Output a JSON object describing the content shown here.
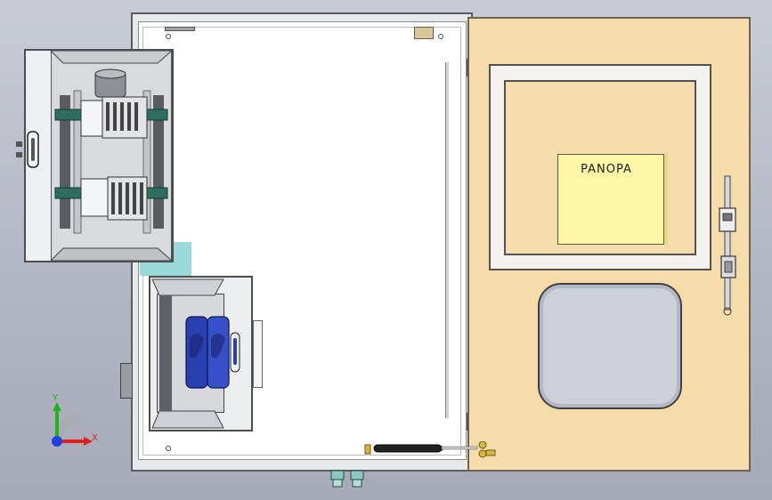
{
  "door": {
    "label": "PANOPA"
  },
  "axes": {
    "x": "X",
    "y": "Y"
  },
  "colors": {
    "background": "#b7bbc6",
    "door": "#f7dcab",
    "label": "#fdf6a6",
    "teal": "#9ad9d9",
    "blue_device": "#2a3fb0",
    "din_rail": "#2e6e60",
    "axis_x": "#e02020",
    "axis_y": "#20b020",
    "axis_z": "#2040e0"
  }
}
